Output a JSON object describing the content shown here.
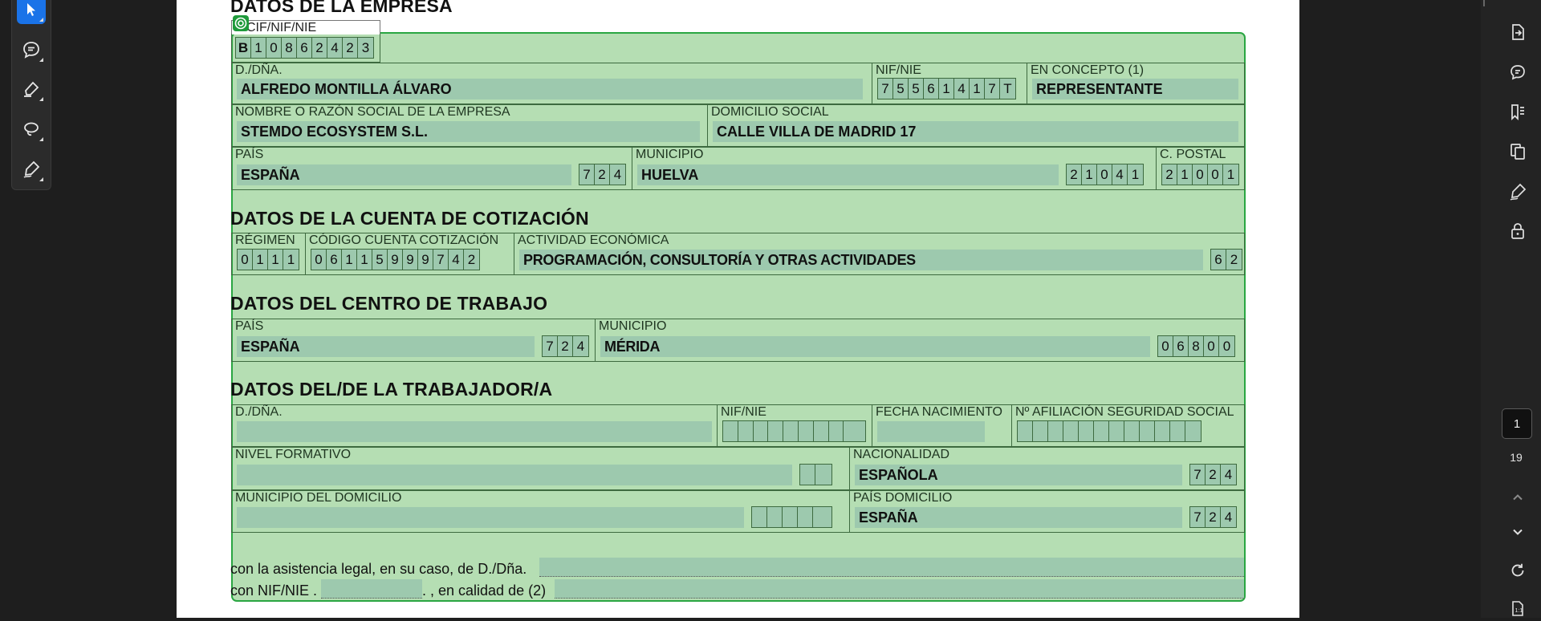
{
  "toolbar_left": {
    "tools": [
      "select-tool",
      "comment-tool",
      "highlight-tool",
      "draw-tool",
      "sign-tool"
    ]
  },
  "toolbar_right": {
    "tools": [
      "export-pdf",
      "comment",
      "bookmarks",
      "organize-pages",
      "fill-sign",
      "protect"
    ]
  },
  "pager": {
    "current_page": "1",
    "total_pages": "19"
  },
  "form": {
    "sections": {
      "empresa": "DATOS DE LA EMPRESA",
      "cuenta": "DATOS DE LA CUENTA DE COTIZACIÓN",
      "centro": "DATOS DEL CENTRO DE TRABAJO",
      "trabajador": "DATOS DEL/DE LA TRABAJADOR/A"
    },
    "empresa": {
      "cif_label": "CIF/NIF/NIE",
      "cif_chars": [
        "B",
        "1",
        "0",
        "8",
        "6",
        "2",
        "4",
        "2",
        "3"
      ],
      "dona_label": "D./DÑA.",
      "dona_value": "ALFREDO MONTILLA ÁLVARO",
      "nif_label": "NIF/NIE",
      "nif_chars": [
        "7",
        "5",
        "5",
        "6",
        "1",
        "4",
        "1",
        "7",
        "T"
      ],
      "concepto_label": "EN CONCEPTO (1)",
      "concepto_value": "REPRESENTANTE",
      "razon_label": "NOMBRE O RAZÓN SOCIAL DE LA EMPRESA",
      "razon_value": "STEMDO ECOSYSTEM  S.L.",
      "domicilio_label": "DOMICILIO SOCIAL",
      "domicilio_value": "CALLE VILLA DE MADRID 17",
      "pais_label": "PAÍS",
      "pais_value": "ESPAÑA",
      "pais_code": [
        "7",
        "2",
        "4"
      ],
      "municipio_label": "MUNICIPIO",
      "municipio_value": "HUELVA",
      "municipio_code": [
        "2",
        "1",
        "0",
        "4",
        "1"
      ],
      "cp_label": "C. POSTAL",
      "cp_chars": [
        "2",
        "1",
        "0",
        "0",
        "1"
      ]
    },
    "cuenta": {
      "regimen_label": "RÉGIMEN",
      "regimen_chars": [
        "0",
        "1",
        "1",
        "1"
      ],
      "ccc_label": "CÓDIGO CUENTA COTIZACIÓN",
      "ccc_chars": [
        "0",
        "6",
        "1",
        "1",
        "5",
        "9",
        "9",
        "9",
        "7",
        "4",
        "2"
      ],
      "actividad_label": "ACTIVIDAD ECONÓMICA",
      "actividad_value": "PROGRAMACIÓN, CONSULTORÍA Y OTRAS ACTIVIDADES",
      "actividad_code": [
        "6",
        "2"
      ]
    },
    "centro": {
      "pais_label": "PAÍS",
      "pais_value": "ESPAÑA",
      "pais_code": [
        "7",
        "2",
        "4"
      ],
      "municipio_label": "MUNICIPIO",
      "municipio_value": "MÉRIDA",
      "municipio_code": [
        "0",
        "6",
        "8",
        "0",
        "0"
      ]
    },
    "trabajador": {
      "dona_label": "D./DÑA.",
      "dona_value": "",
      "nif_label": "NIF/NIE",
      "nif_chars": [
        "",
        "",
        "",
        "",
        "",
        "",
        "",
        "",
        ""
      ],
      "fecha_label": "FECHA NACIMIENTO",
      "fecha_value": "",
      "naf_label": "Nº AFILIACIÓN SEGURIDAD SOCIAL",
      "naf_chars": [
        "",
        "",
        "",
        "",
        "",
        "",
        "",
        "",
        "",
        "",
        "",
        ""
      ],
      "nivel_label": "NIVEL FORMATIVO",
      "nivel_value": "",
      "nivel_code": [
        "",
        ""
      ],
      "nacionalidad_label": "NACIONALIDAD",
      "nacionalidad_value": "ESPAÑOLA",
      "nacionalidad_code": [
        "7",
        "2",
        "4"
      ],
      "munidom_label": "MUNICIPIO DEL DOMICILIO",
      "munidom_value": "",
      "munidom_code": [
        "",
        "",
        "",
        "",
        ""
      ],
      "paisdom_label": "PAÍS DOMICILIO",
      "paisdom_value": "ESPAÑA",
      "paisdom_code": [
        "7",
        "2",
        "4"
      ]
    },
    "footer": {
      "line1": "con la asistencia legal, en su caso, de D./Dña.",
      "line2_a": "con NIF/NIE .",
      "line2_dots": "........................",
      "line2_b": ". , en calidad de (2)"
    }
  }
}
